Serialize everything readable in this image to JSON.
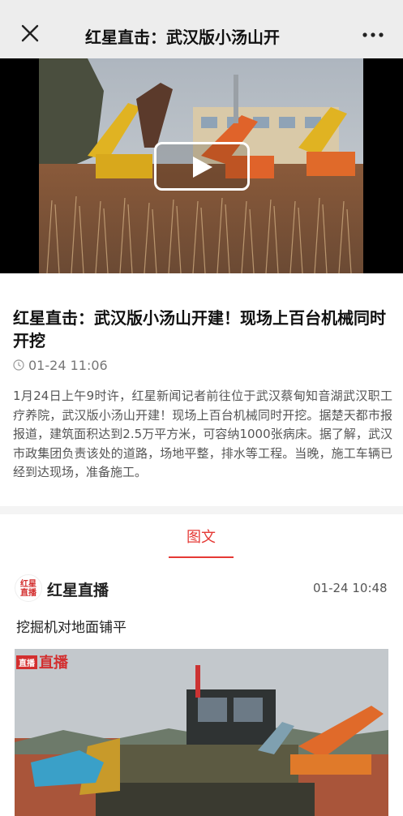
{
  "navbar": {
    "title": "红星直击：武汉版小汤山开",
    "close_icon": "close-icon",
    "more_icon": "more-icon"
  },
  "video": {
    "play_icon": "play-icon"
  },
  "article": {
    "headline": "红星直击：武汉版小汤山开建！现场上百台机械同时开挖",
    "time": "01-24 11:06",
    "summary": "1月24日上午9时许，红星新闻记者前往位于武汉蔡甸知音湖武汉职工疗养院，武汉版小汤山开建！现场上百台机械同时开挖。据楚天都市报报道，建筑面积达到2.5万平方米，可容纳1000张病床。据了解，武汉市政集团负责该处的道路，场地平整，排水等工程。当晚，施工车辆已经到达现场，准备施工。"
  },
  "tabs": [
    {
      "label": "图文",
      "active": true
    }
  ],
  "post": {
    "source_name": "红星直播",
    "source_logo_text": "红星直播",
    "time": "01-24 10:48",
    "text": "挖掘机对地面铺平",
    "image_badge_tag": "直播",
    "image_badge_text": "直播"
  },
  "colors": {
    "accent": "#e53935",
    "navbar_bg": "#ededed"
  }
}
